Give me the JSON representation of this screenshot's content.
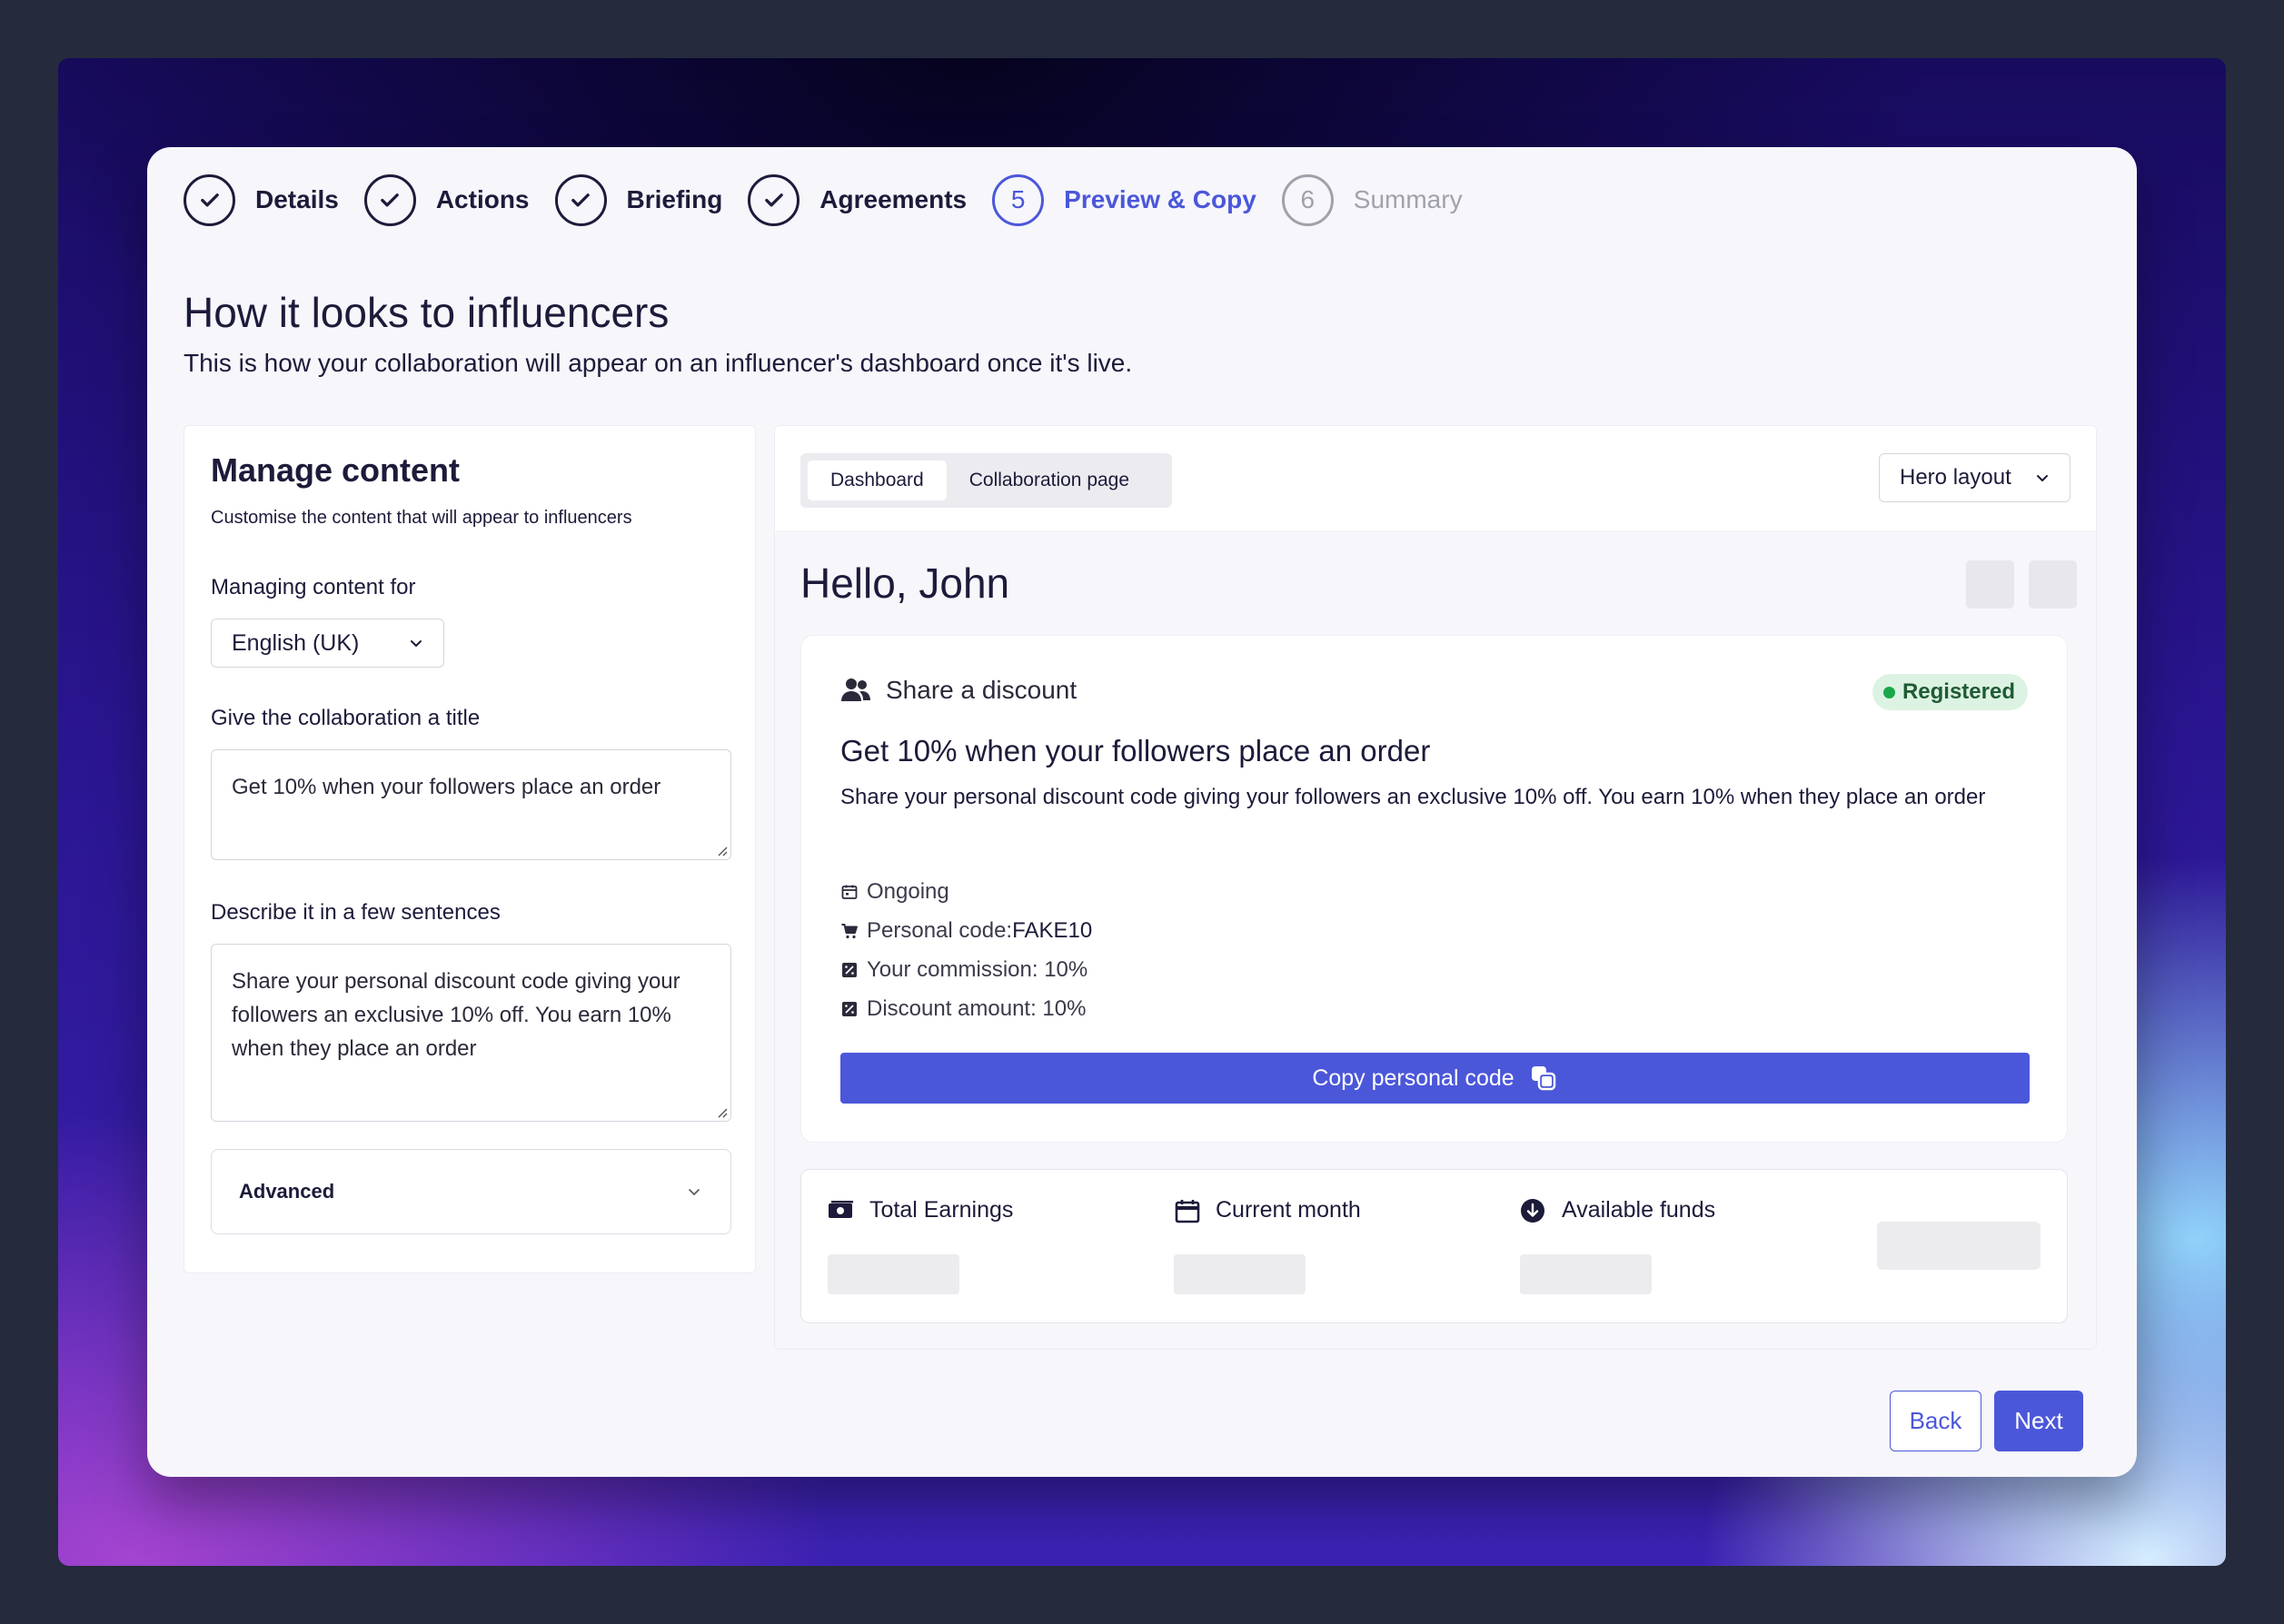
{
  "stepper": {
    "steps": [
      {
        "label": "Details",
        "state": "done"
      },
      {
        "label": "Actions",
        "state": "done"
      },
      {
        "label": "Briefing",
        "state": "done"
      },
      {
        "label": "Agreements",
        "state": "done"
      },
      {
        "label": "Preview & Copy",
        "number": "5",
        "state": "active"
      },
      {
        "label": "Summary",
        "number": "6",
        "state": "pending"
      }
    ]
  },
  "page": {
    "title": "How it looks to influencers",
    "subtitle": "This is how your collaboration will appear on an influencer's dashboard once it's live."
  },
  "manage": {
    "title": "Manage content",
    "subtitle": "Customise the content that will appear to influencers",
    "language_label": "Managing content for",
    "language_value": "English (UK)",
    "title_field_label": "Give the collaboration a title",
    "title_field_value": "Get 10% when your followers place an order",
    "desc_field_label": "Describe it in a few sentences",
    "desc_field_value": "Share your personal discount code giving your followers an exclusive 10% off. You earn 10% when they place an order",
    "advanced_label": "Advanced"
  },
  "preview": {
    "tabs": [
      "Dashboard",
      "Collaboration page"
    ],
    "active_tab": "Dashboard",
    "layout_value": "Hero layout",
    "greeting": "Hello, John",
    "card": {
      "type": "Share a discount",
      "badge": "Registered",
      "title": "Get 10% when your followers place an order",
      "description": "Share your personal discount code giving your followers an exclusive 10% off. You earn 10% when they place an order",
      "meta": {
        "duration": "Ongoing",
        "code_label": "Personal code: ",
        "code_value": "FAKE10",
        "commission": "Your commission: 10%",
        "discount": "Discount amount: 10%"
      },
      "copy_button": "Copy personal code"
    },
    "stats": {
      "total_earnings": "Total Earnings",
      "current_month": "Current month",
      "available_funds": "Available funds"
    }
  },
  "footer": {
    "back_label": "Back",
    "next_label": "Next"
  },
  "colors": {
    "accent": "#4b57d9",
    "text_dark": "#1c1b3a",
    "badge_bg": "#dcf3e3",
    "badge_dot": "#18a84a"
  }
}
